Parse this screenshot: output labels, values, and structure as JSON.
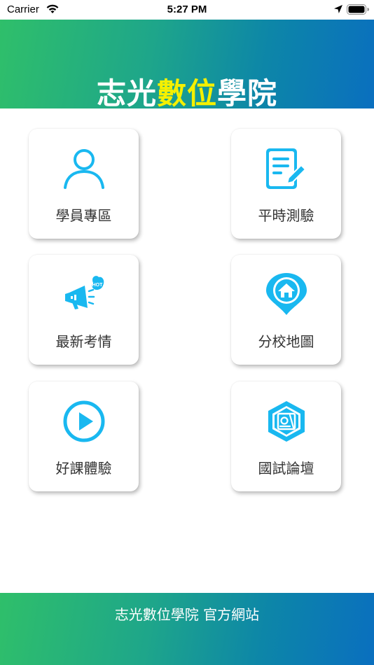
{
  "status_bar": {
    "carrier": "Carrier",
    "time": "5:27 PM"
  },
  "header": {
    "title_part1": "志光",
    "title_highlight": "數位",
    "title_part2": "學院",
    "accent_color": "#f5f000"
  },
  "tiles": [
    {
      "label": "學員專區",
      "icon": "user-icon"
    },
    {
      "label": "平時測驗",
      "icon": "quiz-document-icon"
    },
    {
      "label": "最新考情",
      "icon": "megaphone-hot-icon"
    },
    {
      "label": "分校地圖",
      "icon": "map-pin-home-icon"
    },
    {
      "label": "好課體驗",
      "icon": "play-icon"
    },
    {
      "label": "國試論壇",
      "icon": "forum-guo-icon"
    }
  ],
  "footer": {
    "label": "志光數位學院 官方網站"
  },
  "colors": {
    "icon_cyan": "#19b8f0",
    "gradient_start": "#2fbf6a",
    "gradient_end": "#0a6fbf"
  }
}
